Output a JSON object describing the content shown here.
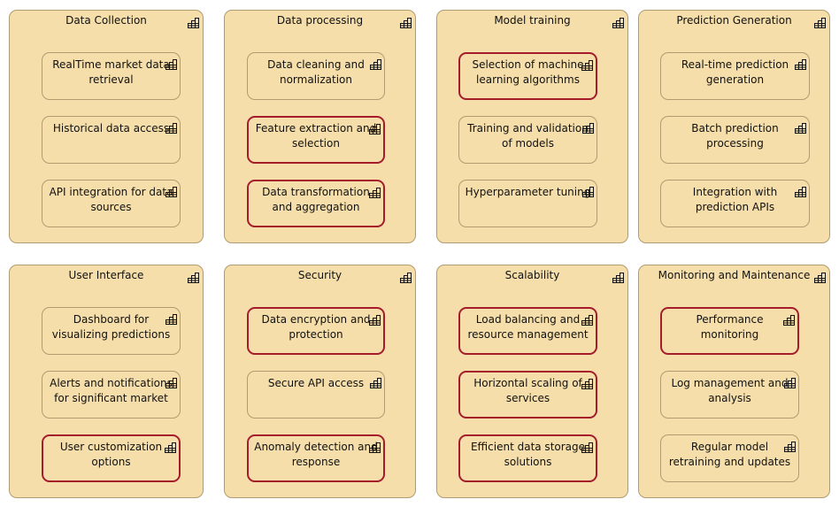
{
  "colors": {
    "fill": "#f5deaa",
    "border": "#b09c70",
    "highlight": "#a51d2d"
  },
  "groups": [
    {
      "title": "Data Collection",
      "icon": "business-function-icon",
      "items": [
        {
          "label": "RealTime market data retrieval",
          "highlighted": false
        },
        {
          "label": "Historical data access",
          "highlighted": false
        },
        {
          "label": "API integration for data sources",
          "highlighted": false
        }
      ]
    },
    {
      "title": "Data processing",
      "icon": "business-function-icon",
      "items": [
        {
          "label": "Data cleaning and normalization",
          "highlighted": false
        },
        {
          "label": "Feature extraction and selection",
          "highlighted": true
        },
        {
          "label": "Data transformation and aggregation",
          "highlighted": true
        }
      ]
    },
    {
      "title": "Model training",
      "icon": "business-function-icon",
      "items": [
        {
          "label": "Selection of machine learning algorithms",
          "highlighted": true
        },
        {
          "label": "Training and validation of models",
          "highlighted": false
        },
        {
          "label": "Hyperparameter tuning",
          "highlighted": false
        }
      ]
    },
    {
      "title": "Prediction Generation",
      "icon": "business-function-icon",
      "items": [
        {
          "label": "Real-time prediction generation",
          "highlighted": false
        },
        {
          "label": "Batch prediction processing",
          "highlighted": false
        },
        {
          "label": "Integration with prediction APIs",
          "highlighted": false
        }
      ]
    },
    {
      "title": "User Interface",
      "icon": "business-function-icon",
      "items": [
        {
          "label": "Dashboard for visualizing predictions",
          "highlighted": false
        },
        {
          "label": "Alerts and notifications for significant market",
          "highlighted": false
        },
        {
          "label": "User customization options",
          "highlighted": true
        }
      ]
    },
    {
      "title": "Security",
      "icon": "business-function-icon",
      "items": [
        {
          "label": "Data encryption and protection",
          "highlighted": true
        },
        {
          "label": "Secure API access",
          "highlighted": false
        },
        {
          "label": "Anomaly detection and response",
          "highlighted": true
        }
      ]
    },
    {
      "title": "Scalability",
      "icon": "business-function-icon",
      "items": [
        {
          "label": "Load balancing and resource management",
          "highlighted": true
        },
        {
          "label": "Horizontal scaling of services",
          "highlighted": true
        },
        {
          "label": "Efficient data storage solutions",
          "highlighted": true
        }
      ]
    },
    {
      "title": "Monitoring and Maintenance",
      "icon": "business-function-icon",
      "items": [
        {
          "label": "Performance monitoring",
          "highlighted": true
        },
        {
          "label": "Log management and analysis",
          "highlighted": false
        },
        {
          "label": "Regular model retraining and updates",
          "highlighted": false
        }
      ]
    }
  ]
}
